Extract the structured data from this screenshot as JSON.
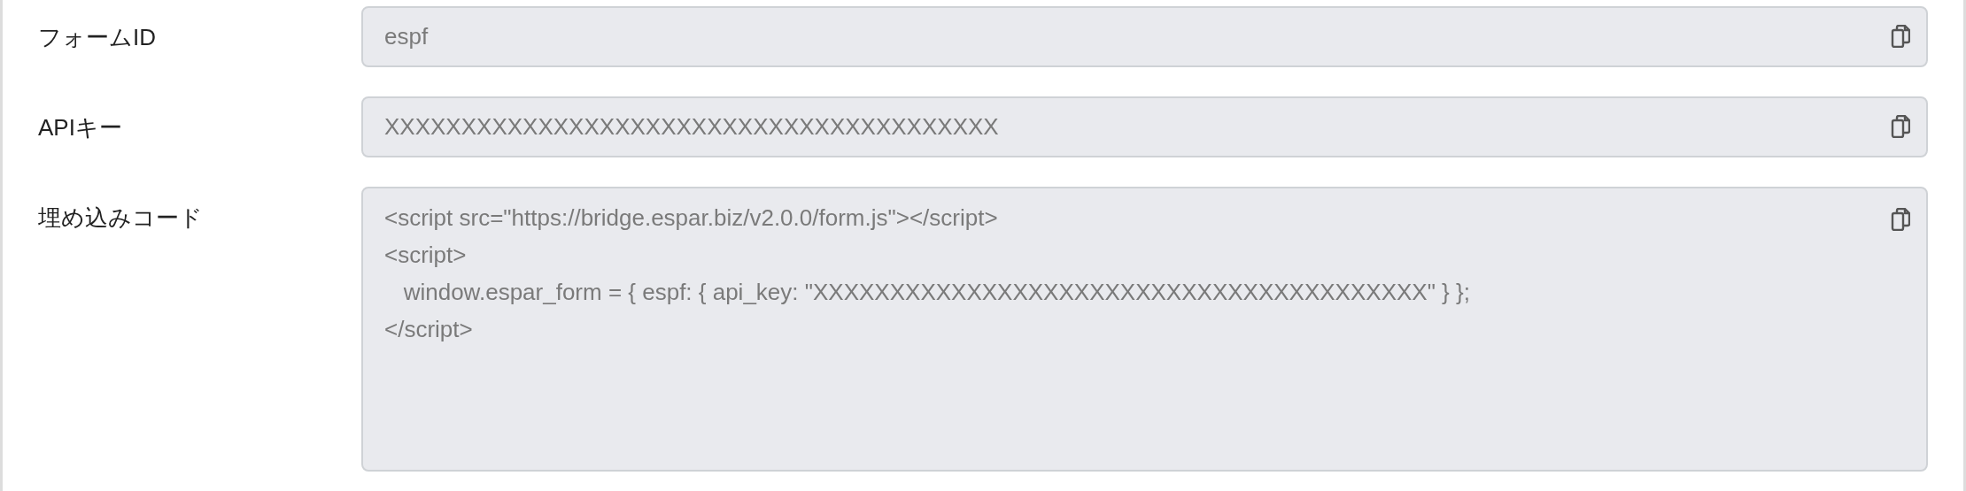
{
  "fields": [
    {
      "kind": "single",
      "label": "フォームID",
      "value": [
        "espf"
      ]
    },
    {
      "kind": "single",
      "label": "APIキー",
      "value": [
        "XXXXXXXXXXXXXXXXXXXXXXXXXXXXXXXXXXXXXXXX"
      ]
    },
    {
      "kind": "multi",
      "label": "埋め込みコード",
      "value": [
        "<script src=\"https://bridge.espar.biz/v2.0.0/form.js\"></script>",
        "<script>",
        "   window.espar_form = { espf: { api_key: \"XXXXXXXXXXXXXXXXXXXXXXXXXXXXXXXXXXXXXXXX\" } };",
        "</script>"
      ]
    }
  ]
}
